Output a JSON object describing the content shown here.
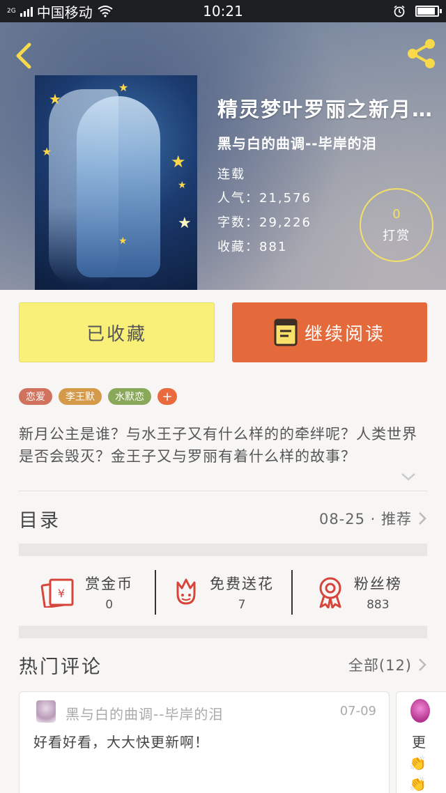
{
  "status_bar": {
    "network_label": "2G",
    "carrier": "中国移动",
    "time": "10:21",
    "battery_level": 0.9,
    "icons": [
      "signal-icon",
      "wifi-icon",
      "alarm-icon",
      "battery-icon"
    ]
  },
  "header": {
    "back_icon": "back-arrow-icon",
    "share_icon": "share-icon",
    "accent_color": "#f7d94a"
  },
  "book": {
    "title": "精灵梦叶罗丽之新月公主",
    "author": "黑与白的曲调--毕岸的泪",
    "status": "连载",
    "popularity": "人气：21,576",
    "word_count": "字数：29,226",
    "favorites": "收藏：881",
    "tip_count": "0",
    "tip_label": "打赏"
  },
  "actions": {
    "collected_label": "已收藏",
    "read_label": "继续阅读",
    "collected_color": "#f9f07a",
    "read_color": "#e56a3b"
  },
  "tags": [
    {
      "label": "恋爱",
      "color": "#d1725e"
    },
    {
      "label": "李王默",
      "color": "#d59a49"
    },
    {
      "label": "水默恋",
      "color": "#8aa85a"
    }
  ],
  "tag_add_label": "+",
  "synopsis": "新月公主是谁？与水王子又有什么样的的牵绊呢？人类世界是否会毁灭？金王子又与罗丽有着什么样的故事？",
  "catalog": {
    "title": "目录",
    "update_info": "08-25 · 推荐"
  },
  "stats": [
    {
      "name": "赏金币",
      "value": "0",
      "icon": "red-envelope-icon"
    },
    {
      "name": "免费送花",
      "value": "7",
      "icon": "flower-icon"
    },
    {
      "name": "粉丝榜",
      "value": "883",
      "icon": "medal-icon"
    }
  ],
  "comments_section": {
    "title": "热门评论",
    "all_label": "全部(12)"
  },
  "comments": [
    {
      "author": "黑与白的曲调--毕岸的泪",
      "date": "07-09",
      "text": "好看好看，大大快更新啊！"
    },
    {
      "text": "更",
      "emoji": "👏"
    }
  ]
}
